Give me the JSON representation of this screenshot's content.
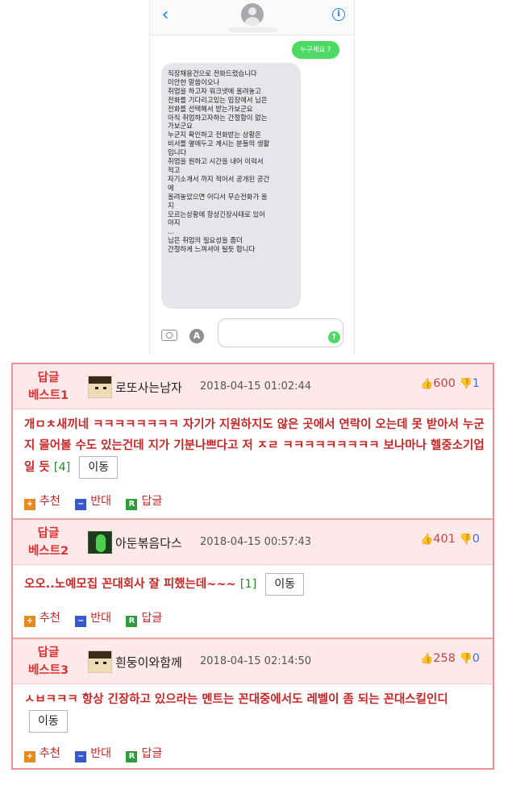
{
  "phone": {
    "outgoing_message": "누구세요 ?",
    "incoming_lines": [
      "직장채용건으로 전화드렸습니다",
      "미안한 말씀이오나",
      "취업을 하고자 워크넷에 올려놓고",
      "전화를 기다리고있는 입장에서 님은",
      "전화를 선택해서 받는가보군요",
      "아직 취업하고자하는 간절함이 없는",
      "가보군요",
      "누군지 확인하고 전화받는 상황은",
      "비서를 옆에두고 계시는 분들의 생활",
      "입니다",
      "취업을 원하고 시간을 내어 이력서",
      "적고",
      "자기소개서 까지 적어서 공개된 공간",
      "에",
      "올려놓았으면 어디서 무슨전화가 올",
      "지",
      "모르는상황에 항상긴장사태로  있어",
      "야지",
      "...",
      "님은  취업의 필요성을 좀더",
      "간절하게 느껴셔야 될듯 합니다"
    ],
    "icons": {
      "back": "chevron-left-icon",
      "info": "info-icon",
      "camera": "camera-icon",
      "appstore": "appstore-icon",
      "send": "send-arrow-icon"
    },
    "colors": {
      "ios_blue": "#1a7cf5",
      "imessage_green": "#4cd964",
      "bubble_gray": "#e5e5ea"
    }
  },
  "comments": [
    {
      "label_line1": "답글",
      "label_line2": "베스트1",
      "username": "로또사는남자",
      "date": "2018-04-15 01:02:44",
      "up": "600",
      "down": "1",
      "text": "개ㅁㅊ새끼네 ㅋㅋㅋㅋㅋㅋㅋㅋ 자기가 지원하지도 않은 곳에서 연락이 오는데 못 받아서 누군지 물어볼 수도 있는건데 지가 기분나쁘다고 저 ㅈㄹ ㅋㅋㅋㅋㅋㅋㅋㅋㅋ 보나마나 헬중소기업일 듯",
      "reply_count": "[4]",
      "move": "이동"
    },
    {
      "label_line1": "답글",
      "label_line2": "베스트2",
      "username": "아둔볶음다스",
      "date": "2018-04-15 00:57:43",
      "up": "401",
      "down": "0",
      "text": "오오..노예모집 꼰대회사 잘 피했는데~~~",
      "reply_count": "[1]",
      "move": "이동"
    },
    {
      "label_line1": "답글",
      "label_line2": "베스트3",
      "username": "흰둥이와함께",
      "date": "2018-04-15 02:14:50",
      "up": "258",
      "down": "0",
      "text": "ㅅㅂㅋㅋㅋ 항상 긴장하고 있으라는 멘트는 꼰대중에서도 레벨이 좀 되는 꼰대스킬인디",
      "reply_count": "",
      "move": "이동"
    }
  ],
  "actions": {
    "recommend": "추천",
    "oppose": "반대",
    "reply": "답글",
    "recommend_icon": "+",
    "oppose_icon": "−",
    "reply_icon": "R"
  },
  "board_colors": {
    "accent_red": "#c82626",
    "header_pink": "#fde9e9",
    "border_pink": "#f08f8f",
    "reply_green": "#2e8a2e",
    "down_blue": "#3e6fd1"
  }
}
